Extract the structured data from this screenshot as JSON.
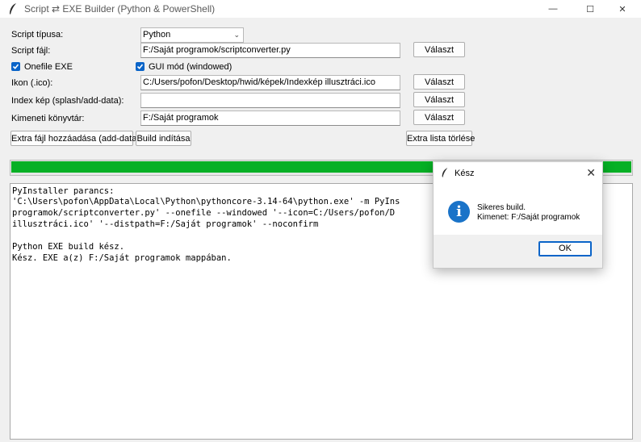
{
  "window": {
    "title": "Script ⇄ EXE Builder (Python & PowerShell)",
    "minimize": "—",
    "maximize": "☐",
    "close": "✕"
  },
  "form": {
    "script_type_label": "Script típusa:",
    "script_type_value": "Python",
    "script_file_label": "Script fájl:",
    "script_file_value": "F:/Saját programok/scriptconverter.py",
    "onefile_label": "Onefile EXE",
    "gui_label": "GUI mód (windowed)",
    "icon_label": "Ikon (.ico):",
    "icon_value": "C:/Users/pofon/Desktop/hwid/képek/Indexkép illusztráci.ico",
    "index_label": "Index kép (splash/add-data):",
    "index_value": "",
    "output_dir_label": "Kimeneti könyvtár:",
    "output_dir_value": "F:/Saját programok",
    "browse_label": "Választ"
  },
  "actions": {
    "add_extra": "Extra fájl hozzáadása (add-data)",
    "build": "Build indítása",
    "clear_extra": "Extra lista törlése"
  },
  "progress": {
    "value": 1.0,
    "color": "#06b025"
  },
  "output_lines": [
    "PyInstaller parancs:",
    "'C:\\Users\\pofon\\AppData\\Local\\Python\\pythoncore-3.14-64\\python.exe' -m PyIns",
    "programok/scriptconverter.py' --onefile --windowed '--icon=C:/Users/pofon/D",
    "illusztráci.ico' '--distpath=F:/Saját programok' --noconfirm",
    "",
    "Python EXE build kész.",
    "Kész. EXE a(z) F:/Saját programok mappában."
  ],
  "dialog": {
    "title": "Kész",
    "close": "✕",
    "icon": "i",
    "message_line1": "Sikeres build.",
    "message_line2": "Kimenet: F:/Saját programok",
    "ok_label": "OK"
  },
  "colors": {
    "accent": "#0a64c8",
    "progress": "#06b025",
    "info": "#1a73c8"
  }
}
